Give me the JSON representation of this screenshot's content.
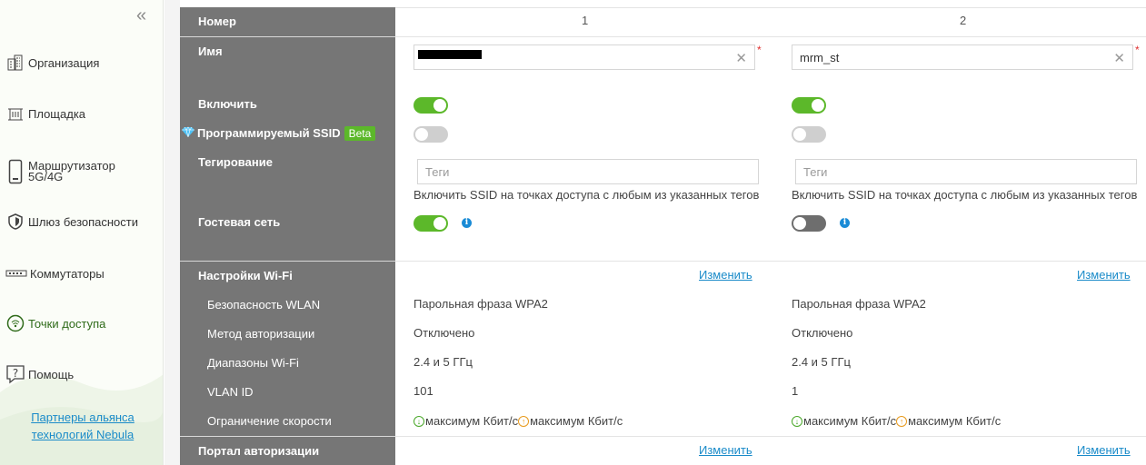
{
  "sidebar": {
    "collapse_glyph": "«",
    "items": [
      {
        "label": "Организация",
        "icon": "building-icon"
      },
      {
        "label": "Площадка",
        "icon": "site-icon"
      },
      {
        "label": "Маршрутизатор 5G/4G",
        "label_line1": "Маршрутизатор",
        "label_line2": "5G/4G",
        "icon": "router-icon"
      },
      {
        "label": "Шлюз безопасности",
        "icon": "shield-icon"
      },
      {
        "label": "Коммутаторы",
        "icon": "switch-icon"
      },
      {
        "label": "Точки доступа",
        "icon": "wifi-ap-icon",
        "active": true
      },
      {
        "label": "Помощь",
        "icon": "help-icon"
      }
    ],
    "partners_line1": "Партнеры альянса",
    "partners_line2": "технологий Nebula"
  },
  "labels": {
    "number": "Номер",
    "name": "Имя",
    "enable": "Включить",
    "programmable_ssid": "Программируемый SSID",
    "beta": "Beta",
    "tagging": "Тегирование",
    "guest_network": "Гостевая сеть",
    "wifi_settings": "Настройки Wi-Fi",
    "wlan_security": "Безопасность WLAN",
    "auth_method": "Метод авторизации",
    "wifi_bands": "Диапазоны Wi-Fi",
    "vlan_id": "VLAN ID",
    "rate_limit": "Ограничение скорости",
    "auth_portal": "Портал авторизации"
  },
  "ssids": [
    {
      "number": "1",
      "name": "",
      "name_redacted": true,
      "enable": true,
      "programmable": false,
      "tags_placeholder": "Теги",
      "tags_help": "Включить SSID на точках доступа с любым из указанных тегов",
      "guest": true,
      "edit_wifi": "Изменить",
      "wlan_security": "Парольная фраза WPA2",
      "auth_method": "Отключено",
      "bands": "2.4 и 5 ГГц",
      "vlan": "101",
      "rate_down": "максимум Кбит/с",
      "rate_up": "максимум Кбит/с",
      "edit_portal": "Изменить"
    },
    {
      "number": "2",
      "name": "mrm_st",
      "name_redacted": false,
      "enable": true,
      "programmable": false,
      "tags_placeholder": "Теги",
      "tags_help": "Включить SSID на точках доступа с любым из указанных тегов",
      "guest": false,
      "edit_wifi": "Изменить",
      "wlan_security": "Парольная фраза WPA2",
      "auth_method": "Отключено",
      "bands": "2.4 и 5 ГГц",
      "vlan": "1",
      "rate_down": "максимум Кбит/с",
      "rate_up": "максимум Кбит/с",
      "edit_portal": "Изменить"
    }
  ],
  "colors": {
    "accent_green": "#5cb82a",
    "label_bg": "#767676",
    "link_blue": "#1a8bc9",
    "required_red": "#e03030"
  }
}
